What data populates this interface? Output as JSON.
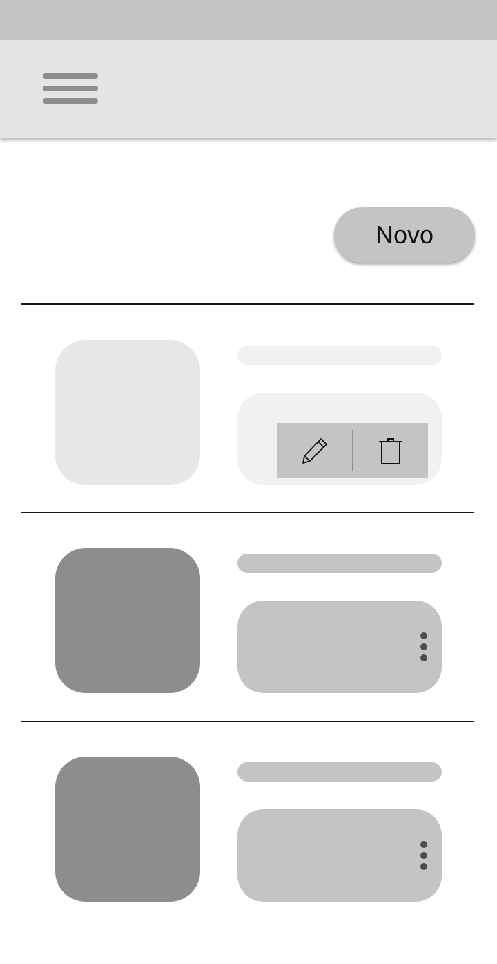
{
  "app": {
    "menu_icon": "hamburger-menu-icon",
    "new_button_label": "Novo"
  },
  "items": [
    {
      "state": "actions-open",
      "actions": [
        {
          "name": "edit",
          "icon": "pencil-icon"
        },
        {
          "name": "delete",
          "icon": "trash-icon"
        }
      ]
    },
    {
      "state": "collapsed",
      "menu_icon": "more-vert-icon"
    },
    {
      "state": "collapsed",
      "menu_icon": "more-vert-icon"
    }
  ],
  "colors": {
    "status_bar": "#c4c4c4",
    "app_bar": "#e5e5e5",
    "placeholder_dark": "#8e8c8d",
    "placeholder_mid": "#c4c4c4",
    "placeholder_light": "#f1f1f1",
    "divider": "#1a1a1a"
  }
}
